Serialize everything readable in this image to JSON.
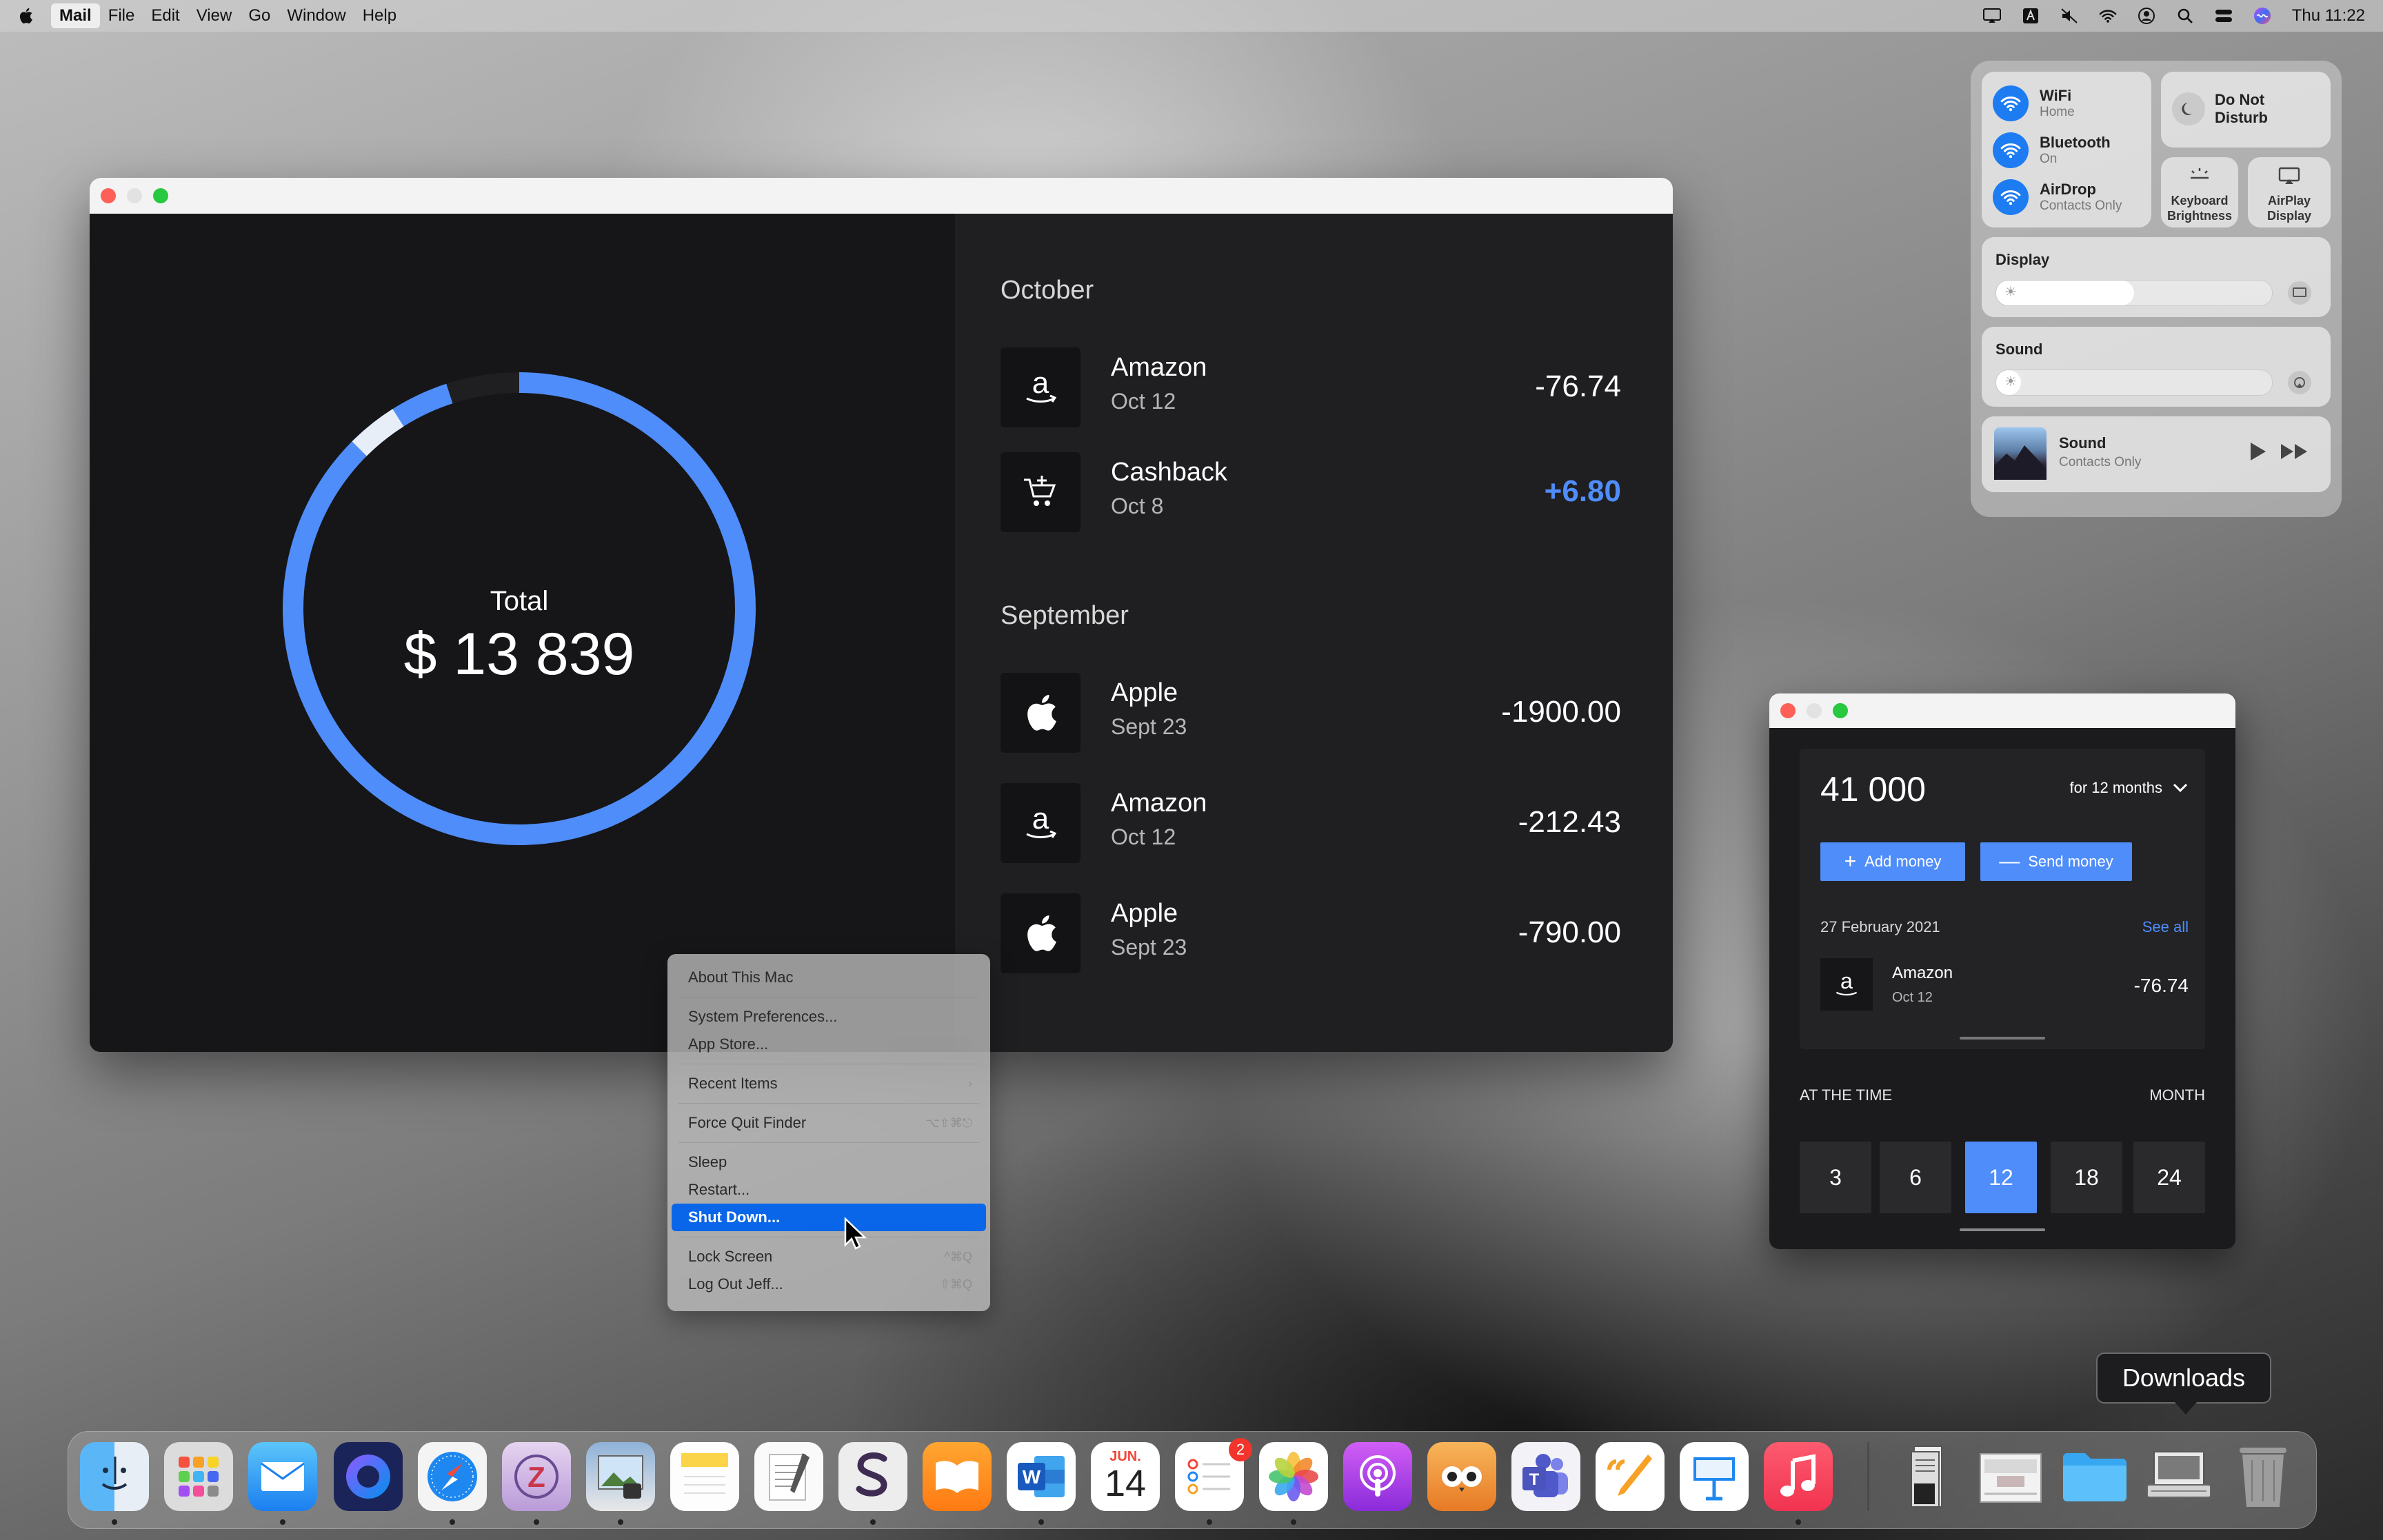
{
  "menubar": {
    "items": [
      "Mail",
      "File",
      "Edit",
      "View",
      "Go",
      "Window",
      "Help"
    ],
    "clock": "Thu 11:22"
  },
  "main": {
    "total_label": "Total",
    "total_value": "$ 13 839",
    "ring_fraction": 0.95,
    "ring_color": "#4f8dfa",
    "groups": [
      {
        "month": "October",
        "items": [
          {
            "icon": "amazon-icon",
            "name": "Amazon",
            "date": "Oct 12",
            "amount": "-76.74",
            "positive": false
          },
          {
            "icon": "cart-icon",
            "name": "Cashback",
            "date": "Oct 8",
            "amount": "+6.80",
            "positive": true
          }
        ]
      },
      {
        "month": "September",
        "items": [
          {
            "icon": "apple-icon",
            "name": "Apple",
            "date": "Sept 23",
            "amount": "-1900.00",
            "positive": false
          },
          {
            "icon": "amazon-icon",
            "name": "Amazon",
            "date": "Oct 12",
            "amount": "-212.43",
            "positive": false
          },
          {
            "icon": "apple-icon",
            "name": "Apple",
            "date": "Sept 23",
            "amount": "-790.00",
            "positive": false
          }
        ]
      }
    ]
  },
  "apple_menu": {
    "items": [
      "About This Mac",
      "System Preferences...",
      "App Store...",
      "Recent Items",
      "Force Quit Finder",
      "Sleep",
      "Restart...",
      "Shut Down...",
      "Lock Screen",
      "Log Out Jeff..."
    ],
    "selected": "Shut Down..."
  },
  "control_center": {
    "wifi": {
      "title": "WiFi",
      "sub": "Home"
    },
    "bluetooth": {
      "title": "Bluetooth",
      "sub": "On"
    },
    "airdrop": {
      "title": "AirDrop",
      "sub": "Contacts Only"
    },
    "dnd": "Do Not Disturb",
    "keyboard": "Keyboard Brightness",
    "airplay": "AirPlay Display",
    "display_label": "Display",
    "display_level": 0.5,
    "sound_label": "Sound",
    "sound_level": 0.05,
    "now_playing": {
      "title": "Sound",
      "sub": "Contacts Only"
    }
  },
  "widget": {
    "balance": "41 000",
    "period": "for 12 months",
    "add_money": "Add money",
    "send_money": "Send money",
    "date": "27 February 2021",
    "see_all": "See all",
    "tx": {
      "name": "Amazon",
      "date": "Oct 12",
      "amount": "-76.74"
    },
    "at_the_time": "AT THE TIME",
    "month": "MONTH",
    "months": [
      "3",
      "6",
      "12",
      "18",
      "24"
    ],
    "selected_month": "12"
  },
  "dock": {
    "tooltip": "Downloads",
    "reminders_badge": "2",
    "calendar_month": "JUN.",
    "calendar_day": "14"
  }
}
